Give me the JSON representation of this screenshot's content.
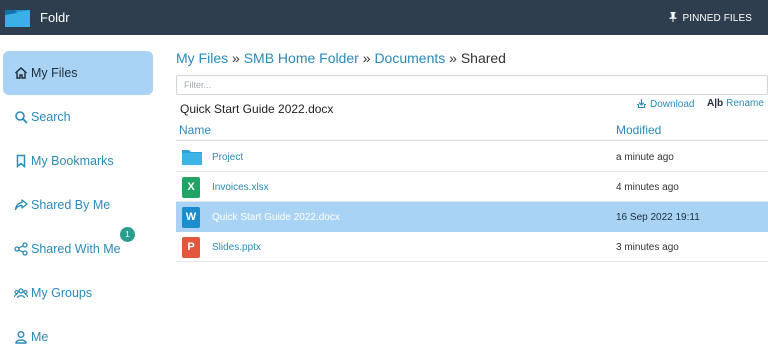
{
  "app": {
    "title": "Foldr",
    "pinned_label": "PINNED FILES"
  },
  "sidebar": {
    "items": [
      {
        "label": "My Files",
        "icon": "home-icon",
        "active": true
      },
      {
        "label": "Search",
        "icon": "search-icon"
      },
      {
        "label": "My Bookmarks",
        "icon": "bookmark-icon"
      },
      {
        "label": "Shared By Me",
        "icon": "share-icon"
      },
      {
        "label": "Shared With Me",
        "icon": "shared-with-icon",
        "badge": "1"
      },
      {
        "label": "My Groups",
        "icon": "groups-icon"
      },
      {
        "label": "Me",
        "icon": "user-icon"
      }
    ]
  },
  "breadcrumb": {
    "items": [
      "My Files",
      "SMB Home Folder",
      "Documents"
    ],
    "separator": "»",
    "current": "Shared"
  },
  "filter": {
    "placeholder": "Filter...",
    "value": ""
  },
  "selection": {
    "title": "Quick Start Guide 2022.docx",
    "download_label": "Download",
    "rename_label": "Rename",
    "rename_prefix": "A|b"
  },
  "table": {
    "columns": [
      "Name",
      "Modified"
    ],
    "rows": [
      {
        "name": "Project",
        "modified": "a minute ago",
        "type": "folder"
      },
      {
        "name": "Invoices.xlsx",
        "modified": "4 minutes ago",
        "type": "xlsx",
        "letter": "X"
      },
      {
        "name": "Quick Start Guide 2022.docx",
        "modified": "16 Sep 2022 19:11",
        "type": "docx",
        "letter": "W",
        "selected": true
      },
      {
        "name": "Slides.pptx",
        "modified": "3 minutes ago",
        "type": "pptx",
        "letter": "P"
      }
    ]
  },
  "colors": {
    "topbar": "#2e3e4e",
    "accent": "#2a8ab8",
    "selected": "#a8d3f5",
    "badge": "#2a9d8f",
    "folder": "#2fa3d8",
    "xlsx": "#21a366",
    "docx": "#1a8ccf",
    "pptx": "#e2573b"
  }
}
